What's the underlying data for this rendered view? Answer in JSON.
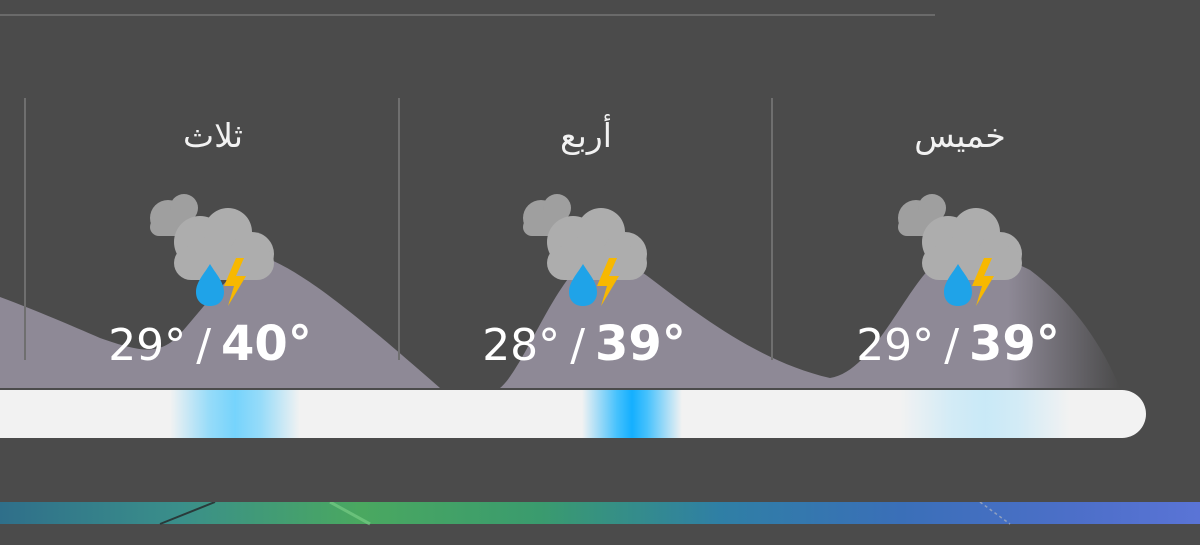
{
  "days": [
    {
      "label": "ثلاث",
      "low": "29°",
      "high": "40°",
      "separator": "/",
      "icon": "thunderstorm-rain-icon"
    },
    {
      "label": "أربع",
      "low": "28°",
      "high": "39°",
      "separator": "/",
      "icon": "thunderstorm-rain-icon"
    },
    {
      "label": "خميس",
      "low": "29°",
      "high": "39°",
      "separator": "/",
      "icon": "thunderstorm-rain-icon"
    }
  ],
  "colors": {
    "background": "#4b4b4b",
    "terrain": "#8e8996",
    "cloud": "#a9a9a9",
    "rain_drop": "#1fa3e8",
    "lightning": "#f7b800",
    "precip_bar": "#f2f2f2",
    "precip_accent": "#4cc9ff"
  }
}
